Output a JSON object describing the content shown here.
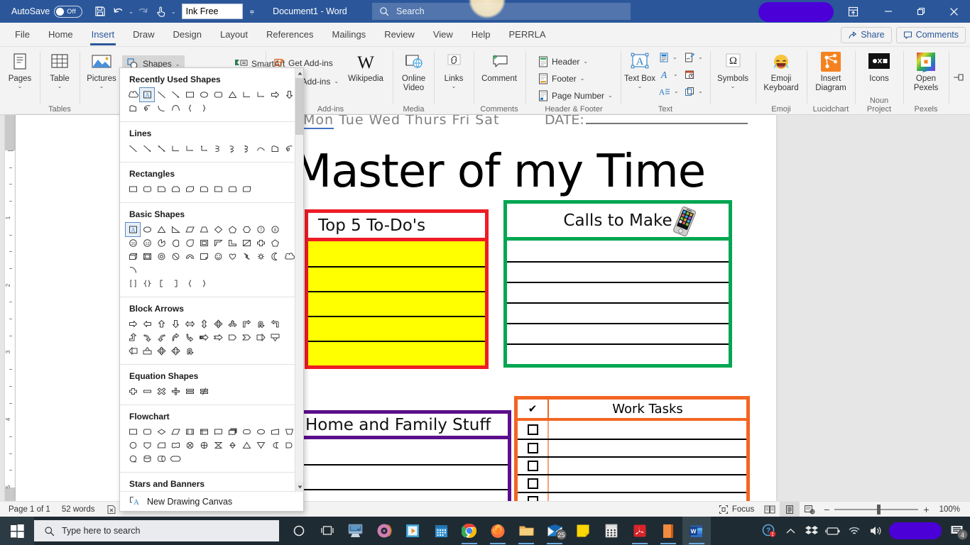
{
  "titlebar": {
    "autosave_label": "AutoSave",
    "autosave_state": "Off",
    "save_icon": "save-icon",
    "undo_icon": "undo-icon",
    "redo_icon": "redo-icon",
    "touch_icon": "touch-mode-icon",
    "font_value": "Ink Free",
    "qat_more": "customize-quick-access-toolbar",
    "document_title": "Document1  -  Word",
    "search_placeholder": "Search",
    "search_icon": "search-icon",
    "ribbon_display_icon": "ribbon-display-options-icon",
    "minimize": "minimize-icon",
    "restore": "restore-icon",
    "close": "close-icon"
  },
  "tabs": [
    {
      "label": "File",
      "active": false
    },
    {
      "label": "Home",
      "active": false
    },
    {
      "label": "Insert",
      "active": true
    },
    {
      "label": "Draw",
      "active": false
    },
    {
      "label": "Design",
      "active": false
    },
    {
      "label": "Layout",
      "active": false
    },
    {
      "label": "References",
      "active": false
    },
    {
      "label": "Mailings",
      "active": false
    },
    {
      "label": "Review",
      "active": false
    },
    {
      "label": "View",
      "active": false
    },
    {
      "label": "Help",
      "active": false
    },
    {
      "label": "PERRLA",
      "active": false
    }
  ],
  "tabstrip_right": {
    "share_label": "Share",
    "comments_label": "Comments"
  },
  "ribbon": {
    "groups": [
      {
        "name": "Pages",
        "label": "",
        "items": [
          {
            "label": "Pages",
            "icon": "pages-icon"
          }
        ]
      },
      {
        "name": "Tables",
        "label": "Tables",
        "items": [
          {
            "label": "Table",
            "icon": "table-icon"
          }
        ]
      },
      {
        "name": "Illustrations",
        "label": "",
        "items": [
          {
            "label": "Pictures",
            "icon": "pictures-icon"
          },
          {
            "label": "Shapes",
            "icon": "shapes-icon"
          },
          {
            "label": "SmartArt",
            "icon": "smartart-icon"
          }
        ]
      },
      {
        "name": "Add-ins",
        "label": "Add-ins",
        "items": [
          {
            "label": "Get Add-ins",
            "icon": "get-add-ins-icon"
          },
          {
            "label": "My Add-ins",
            "icon": "my-add-ins-icon"
          },
          {
            "label": "Wikipedia",
            "icon": "wikipedia-icon"
          }
        ]
      },
      {
        "name": "Media",
        "label": "Media",
        "items": [
          {
            "label": "Online Video",
            "icon": "online-video-icon"
          }
        ]
      },
      {
        "name": "Links",
        "label": "",
        "items": [
          {
            "label": "Links",
            "icon": "links-icon"
          }
        ]
      },
      {
        "name": "Comments",
        "label": "Comments",
        "items": [
          {
            "label": "Comment",
            "icon": "new-comment-icon"
          }
        ]
      },
      {
        "name": "HeaderFooter",
        "label": "Header & Footer",
        "items": [
          {
            "label": "Header",
            "icon": "header-icon"
          },
          {
            "label": "Footer",
            "icon": "footer-icon"
          },
          {
            "label": "Page Number",
            "icon": "page-number-icon"
          }
        ]
      },
      {
        "name": "Text",
        "label": "Text",
        "items": [
          {
            "label": "Text Box",
            "icon": "text-box-icon"
          }
        ]
      },
      {
        "name": "Symbols",
        "label": "",
        "items": [
          {
            "label": "Symbols",
            "icon": "omega-icon"
          }
        ]
      },
      {
        "name": "Emoji",
        "label": "Emoji",
        "items": [
          {
            "label": "Emoji Keyboard",
            "icon": "emoji-keyboard-icon"
          }
        ]
      },
      {
        "name": "Lucidchart",
        "label": "Lucidchart",
        "items": [
          {
            "label": "Insert Diagram",
            "icon": "lucidchart-icon"
          }
        ]
      },
      {
        "name": "NounProject",
        "label": "Noun Project",
        "items": [
          {
            "label": "Icons",
            "icon": "noun-project-icon"
          }
        ]
      },
      {
        "name": "Pexels",
        "label": "Pexels",
        "items": [
          {
            "label": "Open Pexels",
            "icon": "pexels-icon"
          }
        ]
      }
    ],
    "labels": {
      "pages": "Pages",
      "table": "Table",
      "tables_group": "Tables",
      "pictures": "Pictures",
      "shapes": "Shapes",
      "smartart": "SmartArt",
      "get_add_ins": "Get Add-ins",
      "my_add_ins": "My Add-ins",
      "wikipedia": "Wikipedia",
      "add_ins_group": "Add-ins",
      "online_video": "Online Video",
      "media_group": "Media",
      "links": "Links",
      "comment": "Comment",
      "comments_group": "Comments",
      "header": "Header",
      "footer": "Footer",
      "page_number": "Page Number",
      "header_footer_group": "Header & Footer",
      "text_box": "Text Box",
      "text_group": "Text",
      "symbols": "Symbols",
      "emoji_keyboard": "Emoji Keyboard",
      "emoji_group": "Emoji",
      "insert_diagram": "Insert Diagram",
      "lucidchart_group": "Lucidchart",
      "icons": "Icons",
      "noun_project_group": "Noun Project",
      "open_pexels": "Open Pexels",
      "pexels_group": "Pexels"
    }
  },
  "shapes_menu": {
    "sections": [
      {
        "title": "Recently Used Shapes",
        "counts": [
          12,
          6
        ]
      },
      {
        "title": "Lines",
        "counts": [
          12
        ]
      },
      {
        "title": "Rectangles",
        "counts": [
          9
        ]
      },
      {
        "title": "Basic Shapes",
        "counts": [
          11,
          11,
          11,
          6
        ]
      },
      {
        "title": "Block Arrows",
        "counts": [
          11,
          11,
          3
        ]
      },
      {
        "title": "Equation Shapes",
        "counts": [
          6
        ]
      },
      {
        "title": "Flowchart",
        "counts": [
          12,
          11,
          4
        ]
      },
      {
        "title": "Stars and Banners",
        "counts": []
      }
    ],
    "new_drawing_canvas": "New Drawing Canvas",
    "new_drawing_canvas_accel": "N",
    "scroll_up_icon": "scroll-up-arrow-icon",
    "scroll_down_icon": "scroll-down-arrow-icon"
  },
  "document": {
    "days": [
      "Mon",
      "Tue",
      "Wed",
      "Thurs",
      "Fri",
      "Sat"
    ],
    "date_label": "DATE:",
    "title": "Master of my Time",
    "boxes": [
      {
        "name": "top-5-to-dos",
        "header": "Top 5 To-Do's",
        "border_color": "#EE1C25",
        "row_fill": "#FFFF00",
        "rows": 5
      },
      {
        "name": "calls-to-make",
        "header": "Calls to Make",
        "border_color": "#00A651",
        "row_fill": "#FFFFFF",
        "rows": 6,
        "icon": "cell-phone-icon"
      },
      {
        "name": "home-and-family-stuff",
        "header": "Home and Family Stuff",
        "border_color": "#5B0F8B",
        "row_fill": "#FFFFFF",
        "rows": 3
      },
      {
        "name": "work-tasks",
        "header": "Work Tasks",
        "check_header": "✔",
        "border_color": "#F26522",
        "row_fill": "#FFFFFF",
        "rows": 5
      }
    ]
  },
  "statusbar": {
    "page": "Page 1 of 1",
    "words": "52 words",
    "proofing_icon": "proofing-errors-icon",
    "focus_label": "Focus",
    "focus_icon": "focus-icon",
    "read_mode_icon": "read-mode-icon",
    "print_layout_icon": "print-layout-icon",
    "web_layout_icon": "web-layout-icon",
    "zoom_out": "−",
    "zoom_in": "+",
    "zoom_level": "100%"
  },
  "taskbar": {
    "start_icon": "windows-start-icon",
    "search_placeholder": "Type here to search",
    "search_icon": "search-icon",
    "items": [
      {
        "name": "cortana-icon",
        "running": false
      },
      {
        "name": "task-view-icon",
        "running": false
      },
      {
        "name": "remote-desktop-icon",
        "running": false
      },
      {
        "name": "itunes-icon",
        "running": false
      },
      {
        "name": "media-player-icon",
        "running": false
      },
      {
        "name": "calendar-icon",
        "running": false
      },
      {
        "name": "google-chrome-icon",
        "running": true
      },
      {
        "name": "firefox-icon",
        "running": true
      },
      {
        "name": "file-explorer-icon",
        "running": true
      },
      {
        "name": "mail-icon",
        "running": true,
        "badge": "25"
      },
      {
        "name": "sticky-notes-icon",
        "running": false
      },
      {
        "name": "calculator-icon",
        "running": false
      },
      {
        "name": "adobe-acrobat-icon",
        "running": true
      },
      {
        "name": "onenote-icon",
        "running": true
      },
      {
        "name": "word-icon",
        "running": true,
        "active": true
      }
    ],
    "tray": [
      {
        "name": "help-alert-icon"
      },
      {
        "name": "show-hidden-icons-chevron-icon"
      },
      {
        "name": "dropbox-icon"
      },
      {
        "name": "battery-icon"
      },
      {
        "name": "wifi-icon"
      },
      {
        "name": "volume-icon"
      }
    ],
    "notification_badge": "4",
    "notification_icon": "action-center-icon"
  },
  "colors": {
    "word_blue": "#2B579A",
    "ribbon_bg": "#F3F3F3",
    "taskbar": "#1F2B33",
    "redaction": "#4B00D8"
  }
}
